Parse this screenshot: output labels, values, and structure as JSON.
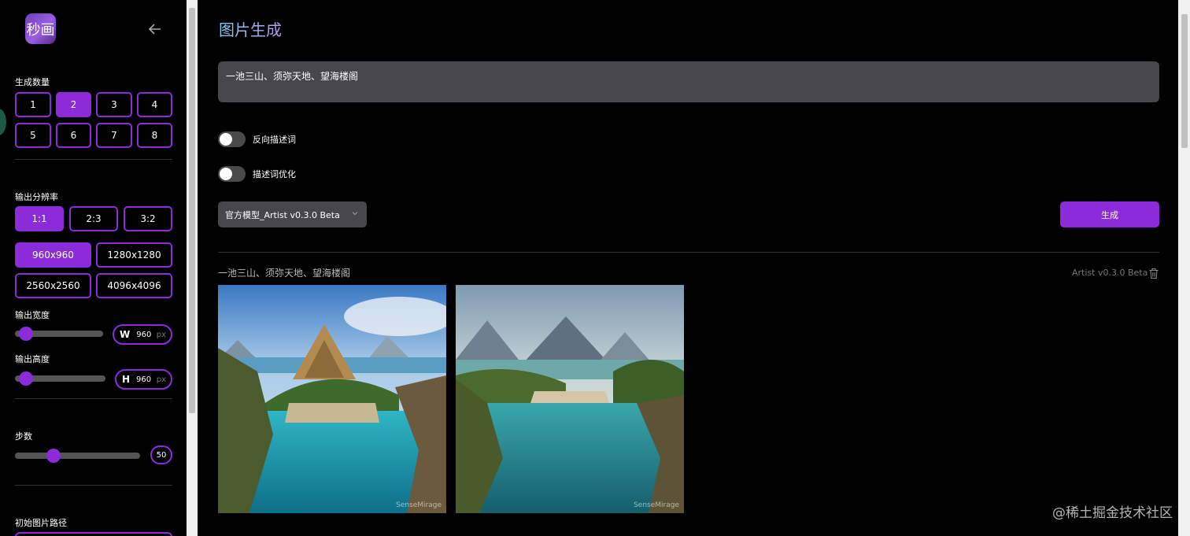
{
  "sidebar": {
    "logo_text": "秒画",
    "count_label": "生成数量",
    "counts": [
      "1",
      "2",
      "3",
      "4",
      "5",
      "6",
      "7",
      "8"
    ],
    "count_selected": "2",
    "resolution_label": "输出分辨率",
    "ratios": [
      "1:1",
      "2:3",
      "3:2"
    ],
    "ratio_selected": "1:1",
    "sizes": [
      "960x960",
      "1280x1280",
      "2560x2560",
      "4096x4096"
    ],
    "size_selected": "960x960",
    "width_label": "输出宽度",
    "width_prefix": "W",
    "width_value": "960",
    "height_label": "输出高度",
    "height_prefix": "H",
    "height_value": "960",
    "unit": "px",
    "steps_label": "步数",
    "steps_value": "50",
    "init_image_label": "初始图片路径"
  },
  "main": {
    "title": "图片生成",
    "prompt_value": "一池三山、须弥天地、望海楼阁",
    "negative_toggle_label": "反向描述词",
    "optimize_toggle_label": "描述词优化",
    "model_selected": "官方模型_Artist v0.3.0 Beta",
    "generate_label": "生成",
    "result": {
      "prompt": "一池三山、须弥天地、望海楼阁",
      "model": "Artist v0.3.0 Beta",
      "image_watermark": "SenseMirage"
    }
  },
  "page_watermark": "@稀土掘金技术社区",
  "colors": {
    "accent": "#8b2bd9",
    "input_bg": "#47464c"
  }
}
